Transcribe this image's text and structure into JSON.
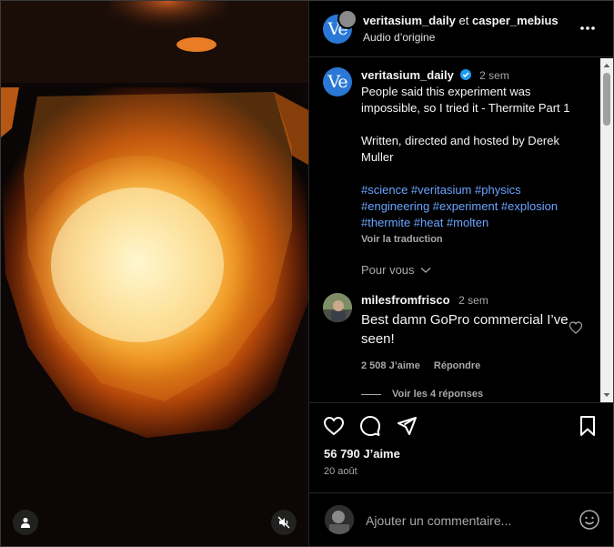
{
  "header": {
    "author1": "veritasium_daily",
    "joiner": "et",
    "author2": "casper_mebius",
    "audio": "Audio d’origine",
    "avatar_text": "Ve"
  },
  "caption": {
    "username": "veritasium_daily",
    "time": "2 sem",
    "lines": [
      "People said this experiment was impossible, so I tried it - Thermite Part 1",
      "Written, directed and hosted by Derek Muller"
    ],
    "hashtags": "#science #veritasium #physics #engineering #experiment #explosion #thermite #heat #molten",
    "translate": "Voir la traduction"
  },
  "for_you": "Pour vous",
  "comment": {
    "username": "milesfromfrisco",
    "time": "2 sem",
    "text": "Best damn GoPro commercial I’ve seen!",
    "likes": "2 508 J’aime",
    "reply": "Répondre",
    "view_replies": "Voir les 4 réponses"
  },
  "post": {
    "likes": "56 790 J’aime",
    "date": "20 août"
  },
  "add_comment": {
    "placeholder": "Ajouter un commentaire..."
  },
  "colors": {
    "accent_link": "#6aa4ff",
    "verified": "#1d9bf0",
    "avatar_bg": "#2a78d6"
  }
}
